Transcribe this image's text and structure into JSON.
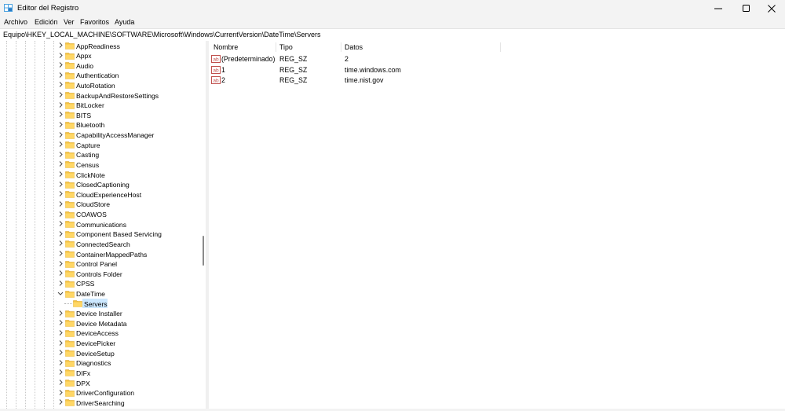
{
  "window": {
    "title": "Editor del Registro",
    "icons": [
      "registry-editor-icon",
      "minimize-icon",
      "maximize-icon",
      "close-icon"
    ]
  },
  "menu": [
    "Archivo",
    "Edición",
    "Ver",
    "Favoritos",
    "Ayuda"
  ],
  "address": "Equipo\\HKEY_LOCAL_MACHINE\\SOFTWARE\\Microsoft\\Windows\\CurrentVersion\\DateTime\\Servers",
  "tree": {
    "items": [
      {
        "label": "AppReadiness"
      },
      {
        "label": "Appx"
      },
      {
        "label": "Audio"
      },
      {
        "label": "Authentication"
      },
      {
        "label": "AutoRotation"
      },
      {
        "label": "BackupAndRestoreSettings"
      },
      {
        "label": "BitLocker"
      },
      {
        "label": "BITS"
      },
      {
        "label": "Bluetooth"
      },
      {
        "label": "CapabilityAccessManager"
      },
      {
        "label": "Capture"
      },
      {
        "label": "Casting"
      },
      {
        "label": "Census"
      },
      {
        "label": "ClickNote"
      },
      {
        "label": "ClosedCaptioning"
      },
      {
        "label": "CloudExperienceHost"
      },
      {
        "label": "CloudStore"
      },
      {
        "label": "COAWOS"
      },
      {
        "label": "Communications"
      },
      {
        "label": "Component Based Servicing"
      },
      {
        "label": "ConnectedSearch"
      },
      {
        "label": "ContainerMappedPaths"
      },
      {
        "label": "Control Panel"
      },
      {
        "label": "Controls Folder"
      },
      {
        "label": "CPSS"
      },
      {
        "label": "DateTime"
      },
      {
        "label": "Servers"
      },
      {
        "label": "Device Installer"
      },
      {
        "label": "Device Metadata"
      },
      {
        "label": "DeviceAccess"
      },
      {
        "label": "DevicePicker"
      },
      {
        "label": "DeviceSetup"
      },
      {
        "label": "Diagnostics"
      },
      {
        "label": "DIFx"
      },
      {
        "label": "DPX"
      },
      {
        "label": "DriverConfiguration"
      },
      {
        "label": "DriverSearching"
      }
    ],
    "selected": "Servers",
    "expanded": "DateTime"
  },
  "list": {
    "columns": [
      "Nombre",
      "Tipo",
      "Datos"
    ],
    "rows": [
      {
        "name": "(Predeterminado)",
        "type": "REG_SZ",
        "data": "2"
      },
      {
        "name": "1",
        "type": "REG_SZ",
        "data": "time.windows.com"
      },
      {
        "name": "2",
        "type": "REG_SZ",
        "data": "time.nist.gov"
      }
    ]
  },
  "colors": {
    "selection": "#cce8ff",
    "folder": "#f5c342",
    "window_bg": "#f3f3f3"
  }
}
